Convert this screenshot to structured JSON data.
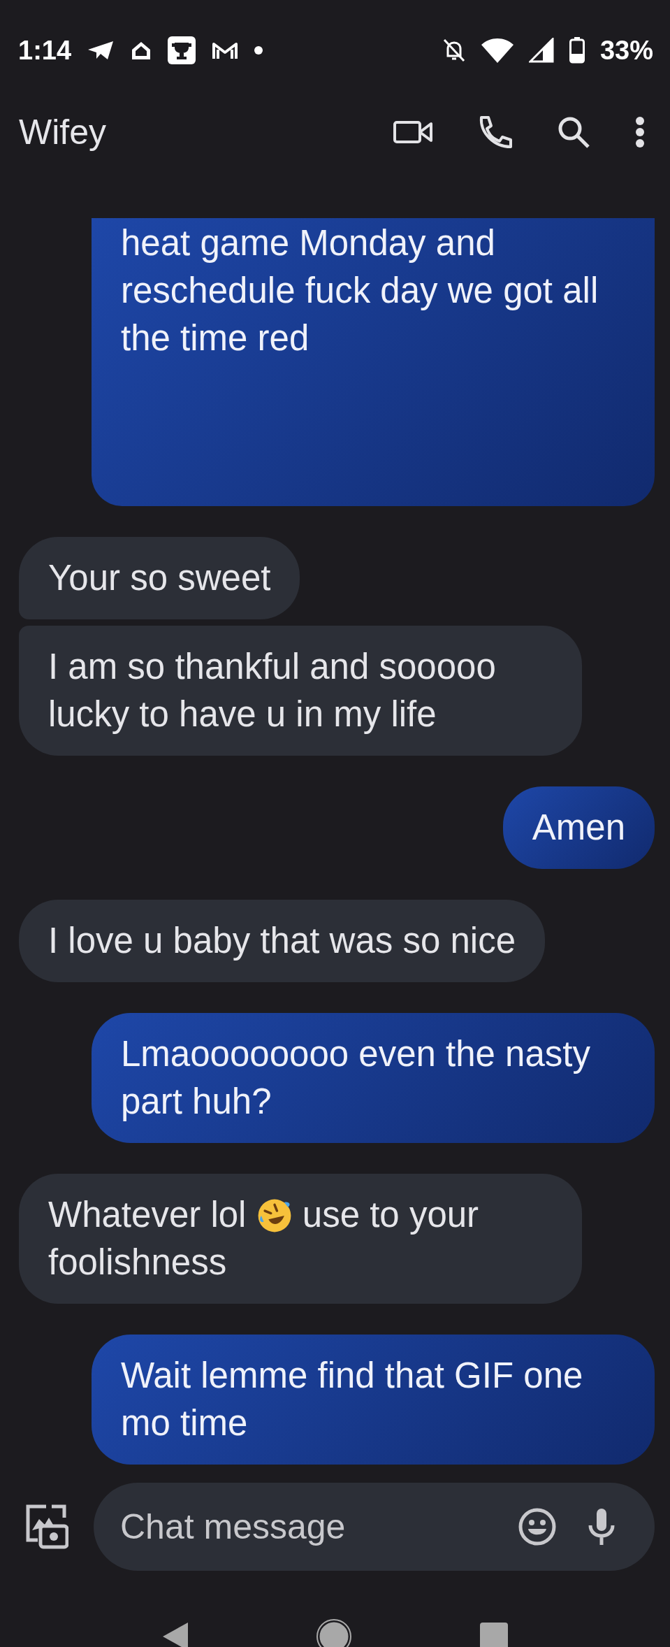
{
  "status_bar": {
    "time": "1:14",
    "battery": "33%"
  },
  "header": {
    "title": "Wifey"
  },
  "messages": [
    {
      "kind": "sent",
      "cut_top": true,
      "parts": [
        {
          "kind": "text",
          "text": "heat game Monday and reschedule fuck day we got all the time red"
        }
      ]
    },
    {
      "kind": "received",
      "parts": [
        {
          "kind": "text",
          "text": "Your so sweet"
        }
      ]
    },
    {
      "kind": "received",
      "parts": [
        {
          "kind": "text",
          "text": "I am so thankful and sooooo lucky to have u in my life"
        }
      ]
    },
    {
      "kind": "sent",
      "parts": [
        {
          "kind": "text",
          "text": "Amen"
        }
      ]
    },
    {
      "kind": "received",
      "parts": [
        {
          "kind": "text",
          "text": "I love u baby that was so nice"
        }
      ]
    },
    {
      "kind": "sent",
      "parts": [
        {
          "kind": "text",
          "text": "Lmaoooooooo even the nasty part huh?"
        }
      ]
    },
    {
      "kind": "received",
      "parts": [
        {
          "kind": "text",
          "text": "Whatever lol"
        },
        {
          "kind": "emoji"
        },
        {
          "kind": "text",
          "text": "use to your foolishness"
        }
      ]
    },
    {
      "kind": "sent",
      "parts": [
        {
          "kind": "text",
          "text": "Wait lemme find that GIF one mo time"
        }
      ]
    }
  ],
  "composer": {
    "placeholder": "Chat message"
  }
}
